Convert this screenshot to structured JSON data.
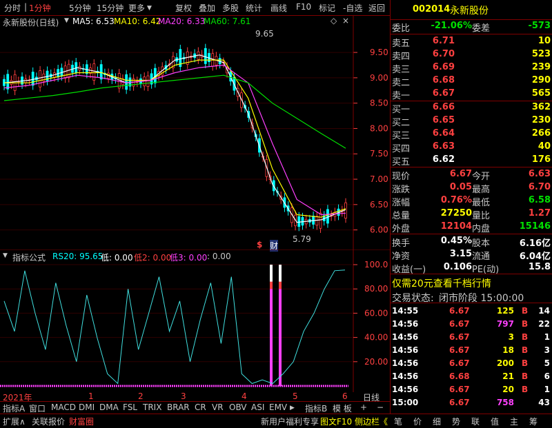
{
  "toolbar": {
    "left_items": [
      "分时",
      "1分钟",
      "5分钟",
      "15分钟",
      "更多"
    ],
    "right_items": [
      "复权",
      "叠加",
      "多股",
      "统计",
      "画线",
      "F10",
      "标记",
      "-自选",
      "返回"
    ]
  },
  "quote": {
    "code": "002014",
    "name": "永新股份",
    "weibi_label": "委比",
    "weibi_value": "-21.06%",
    "weicha_label": "委差",
    "weicha_value": "-573",
    "sell": [
      {
        "label": "卖五",
        "price": "6.71",
        "vol": "10"
      },
      {
        "label": "卖四",
        "price": "6.70",
        "vol": "523"
      },
      {
        "label": "卖三",
        "price": "6.69",
        "vol": "239"
      },
      {
        "label": "卖二",
        "price": "6.68",
        "vol": "290"
      },
      {
        "label": "卖一",
        "price": "6.67",
        "vol": "565"
      }
    ],
    "buy": [
      {
        "label": "买一",
        "price": "6.66",
        "vol": "362"
      },
      {
        "label": "买二",
        "price": "6.65",
        "vol": "230"
      },
      {
        "label": "买三",
        "price": "6.64",
        "vol": "266"
      },
      {
        "label": "买四",
        "price": "6.63",
        "vol": "40"
      },
      {
        "label": "买五",
        "price": "6.62",
        "vol": "176"
      }
    ],
    "stats": [
      {
        "l1": "现价",
        "v1": "6.67",
        "l2": "今开",
        "v2": "6.63"
      },
      {
        "l1": "涨跌",
        "v1": "0.05",
        "l2": "最高",
        "v2": "6.70"
      },
      {
        "l1": "涨幅",
        "v1": "0.76%",
        "l2": "最低",
        "v2": "6.58"
      },
      {
        "l1": "总量",
        "v1": "27250",
        "l2": "量比",
        "v2": "1.27"
      },
      {
        "l1": "外盘",
        "v1": "12104",
        "l2": "内盘",
        "v2": "15146"
      }
    ],
    "stats2": [
      {
        "l1": "换手",
        "v1": "0.45%",
        "l2": "股本",
        "v2": "6.16亿"
      },
      {
        "l1": "净资",
        "v1": "3.15",
        "l2": "流通",
        "v2": "6.04亿"
      },
      {
        "l1": "收益(一)",
        "v1": "0.106",
        "l2": "PE(动)",
        "v2": "15.8"
      }
    ],
    "promo": "仅需20元查看千档行情",
    "status_label": "交易状态:",
    "status_value": "闭市阶段 15:00:00",
    "ticks": [
      {
        "time": "14:55",
        "price": "6.67",
        "vol": "125",
        "side": "B",
        "n": "14"
      },
      {
        "time": "14:56",
        "price": "6.67",
        "vol": "797",
        "side": "B",
        "n": "22"
      },
      {
        "time": "14:56",
        "price": "6.67",
        "vol": "3",
        "side": "B",
        "n": "1"
      },
      {
        "time": "14:56",
        "price": "6.67",
        "vol": "18",
        "side": "B",
        "n": "3"
      },
      {
        "time": "14:56",
        "price": "6.67",
        "vol": "200",
        "side": "B",
        "n": "5"
      },
      {
        "time": "14:56",
        "price": "6.68",
        "vol": "21",
        "side": "B",
        "n": "6"
      },
      {
        "time": "14:56",
        "price": "6.67",
        "vol": "20",
        "side": "B",
        "n": "1"
      },
      {
        "time": "15:00",
        "price": "6.67",
        "vol": "758",
        "side": "",
        "n": "43"
      }
    ]
  },
  "legend": {
    "title": "永新股份(日线)",
    "ma5": "MA5: 6.53",
    "ma10": "MA10: 6.42",
    "ma20": "MA20: 6.33",
    "ma60": "MA60: 7.61",
    "hi_label": "9.65",
    "lo_label": "5.79",
    "marker1": "$",
    "marker2": "财"
  },
  "indicator": {
    "name": "指标公式",
    "rs20": "RS20: 95.65",
    "di": "低: 0.00",
    "di2": "低2: 0.00",
    "di3": "低3: 0.00",
    "tail": ": 0.00"
  },
  "axes": {
    "price_ticks": [
      "9.50",
      "9.00",
      "8.50",
      "8.00",
      "7.50",
      "7.00",
      "6.50",
      "6.00"
    ],
    "ind_ticks": [
      "100.0",
      "80.00",
      "60.00",
      "40.00",
      "20.00"
    ],
    "x_labels": [
      "2021年",
      "1",
      "2",
      "3",
      "4",
      "5",
      "6"
    ]
  },
  "tabs": {
    "left": [
      "指标A",
      "窗口",
      "MACD",
      "DMI",
      "DMA",
      "FSL",
      "TRIX",
      "BRAR",
      "CR",
      "VR",
      "OBV",
      "ASI",
      "EMV",
      "▶"
    ],
    "right": [
      "指标B",
      "模 板",
      "+",
      "−"
    ],
    "period": "日线"
  },
  "bottom": {
    "left": [
      "扩展∧",
      "关联报价",
      "财富圈"
    ],
    "mid": [
      "新用户福利专享",
      "图文F10",
      "侧边栏《"
    ],
    "right": [
      "笔",
      "价",
      "细",
      "势",
      "联",
      "值",
      "主",
      "筹"
    ]
  },
  "colors": {
    "up": "#ff4040",
    "down": "#00ffff",
    "ma5": "#ffffff",
    "ma10": "#ffff00",
    "ma20": "#ff40ff",
    "ma60": "#00e000",
    "grid": "#800000"
  },
  "chart_data": [
    {
      "type": "line",
      "title": "永新股份(日线)",
      "ylim": [
        5.75,
        9.8
      ],
      "x": [
        "2021年",
        "1",
        "2",
        "3",
        "4",
        "5",
        "6"
      ],
      "series": [
        {
          "name": "MA5",
          "values": [
            8.9,
            8.95,
            9.05,
            9.2,
            9.1,
            8.9,
            8.95,
            9.35,
            9.45,
            9.3,
            8.3,
            6.9,
            6.15,
            6.2,
            6.4
          ]
        },
        {
          "name": "MA10",
          "values": [
            8.9,
            8.9,
            9.0,
            9.1,
            9.1,
            8.95,
            8.95,
            9.25,
            9.35,
            9.35,
            8.6,
            7.2,
            6.3,
            6.25,
            6.42
          ]
        },
        {
          "name": "MA20",
          "values": [
            8.8,
            8.85,
            8.95,
            9.05,
            9.0,
            8.9,
            8.95,
            9.1,
            9.2,
            9.25,
            8.9,
            7.7,
            6.6,
            6.3,
            6.33
          ]
        },
        {
          "name": "MA60",
          "values": [
            8.55,
            8.6,
            8.65,
            8.72,
            8.8,
            8.85,
            8.9,
            8.95,
            9.0,
            9.05,
            8.9,
            8.5,
            8.2,
            7.9,
            7.61
          ]
        }
      ]
    },
    {
      "type": "line",
      "title": "指标公式",
      "ylim": [
        0,
        100
      ],
      "series": [
        {
          "name": "RS20",
          "values": [
            70,
            45,
            95,
            60,
            30,
            85,
            50,
            20,
            75,
            40,
            10,
            2,
            80,
            30,
            60,
            90,
            45,
            70,
            20,
            55,
            85,
            35,
            90,
            10,
            2,
            5,
            2,
            10,
            20,
            45,
            60,
            80,
            95,
            95.65
          ]
        }
      ]
    }
  ]
}
